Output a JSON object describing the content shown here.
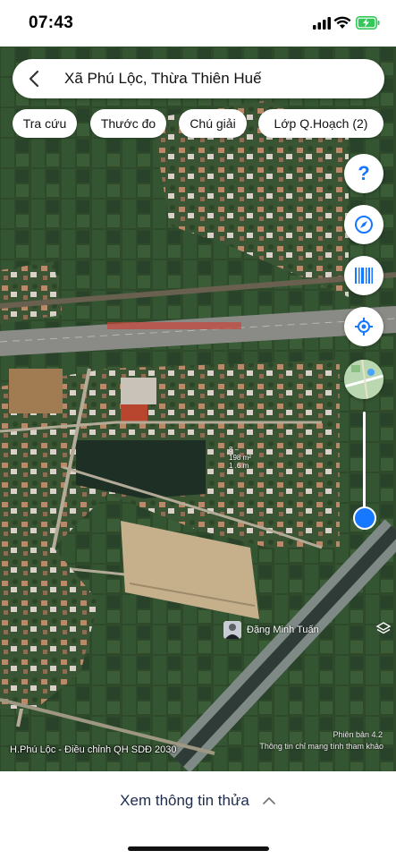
{
  "status": {
    "time": "07:43"
  },
  "search": {
    "location": "Xã Phú Lộc, Thừa Thiên Huế"
  },
  "chips": [
    "Tra cứu",
    "Thước đo",
    "Chú giải",
    "Lớp Q.Hoạch (2)"
  ],
  "map_overlay": {
    "parcel_label_1": "8 –",
    "parcel_label_2": "198 m²",
    "parcel_label_3": "1 .6 m",
    "owner_name": "Đặng Minh Tuấn",
    "version": "Phiên bản 4.2",
    "disclaimer": "Thông tin chỉ mang tính tham khảo",
    "plan_label": "H.Phú Lộc - Điều chỉnh QH SDĐ 2030"
  },
  "bottom": {
    "view_parcel_label": "Xem thông tin thửa"
  },
  "colors": {
    "accent": "#1677ff",
    "map_green": "#2f4a2f",
    "road": "#8a8a86"
  },
  "icons": [
    "back-chevron-icon",
    "help-icon",
    "compass-icon",
    "barcode-icon",
    "locate-icon",
    "map-thumbnail-icon",
    "layers-icon",
    "chevron-up-icon"
  ]
}
